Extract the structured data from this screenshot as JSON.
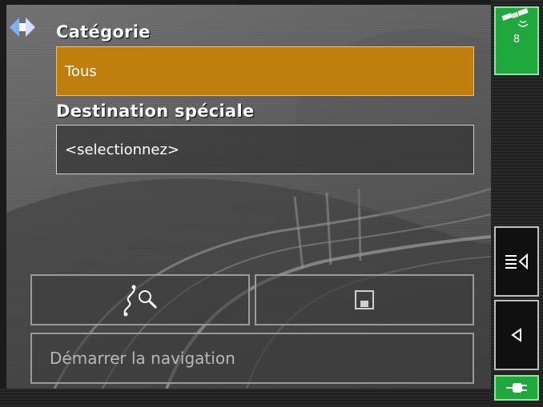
{
  "form": {
    "category_label": "Catégorie",
    "category_value": "Tous",
    "poi_label": "Destination spéciale",
    "poi_value": "<selectionnez>"
  },
  "actions": {
    "start_navigation_label": "Démarrer la navigation",
    "search_button_icon": "route-search-icon",
    "save_button_icon": "floppy-disk-icon"
  },
  "sidebar": {
    "gps_satellite_count": "8",
    "gps_icon": "satellite-icon",
    "menu_icon": "menu-lines-icon",
    "back_icon": "triangle-left-icon",
    "power_icon": "power-plug-icon"
  },
  "colors": {
    "selected_field": "#c07f0c",
    "gps_green": "#1fa83b",
    "text": "#ffffff"
  }
}
